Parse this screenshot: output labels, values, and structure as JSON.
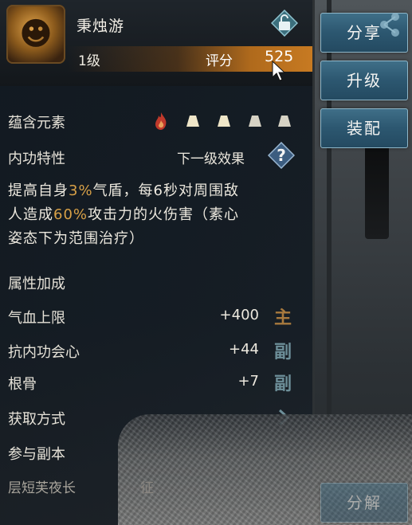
{
  "item": {
    "name": "秉烛游",
    "level": "1级",
    "score_label": "评分",
    "score_value": "525"
  },
  "elements": {
    "label": "蕴含元素"
  },
  "internal": {
    "label": "内功特性",
    "next_effect": "下一级效果",
    "desc_parts": [
      "提高自身",
      "3%",
      "气盾，每6秒对周围敌",
      "人造成",
      "60%",
      "攻击力的火伤害（素心",
      "姿态下为范围治疗）"
    ]
  },
  "attributes": {
    "label": "属性加成",
    "rows": [
      {
        "name": "气血上限",
        "value": "+400",
        "tag": "主"
      },
      {
        "name": "抗内功会心",
        "value": "+44",
        "tag": "副"
      },
      {
        "name": "根骨",
        "value": "+7",
        "tag": "副"
      }
    ]
  },
  "acquire": {
    "label": "获取方式",
    "method": "参与副本",
    "partial": "层短芙夜长",
    "partial2": "征"
  },
  "buttons": {
    "share": "分享",
    "upgrade": "升级",
    "equip": "装配",
    "dismantle": "分解"
  },
  "colors": {
    "highlight": "#d8a047",
    "main_tag": "#a87a3e",
    "sub_tag": "#6d8f99",
    "button": "#2c5770"
  }
}
